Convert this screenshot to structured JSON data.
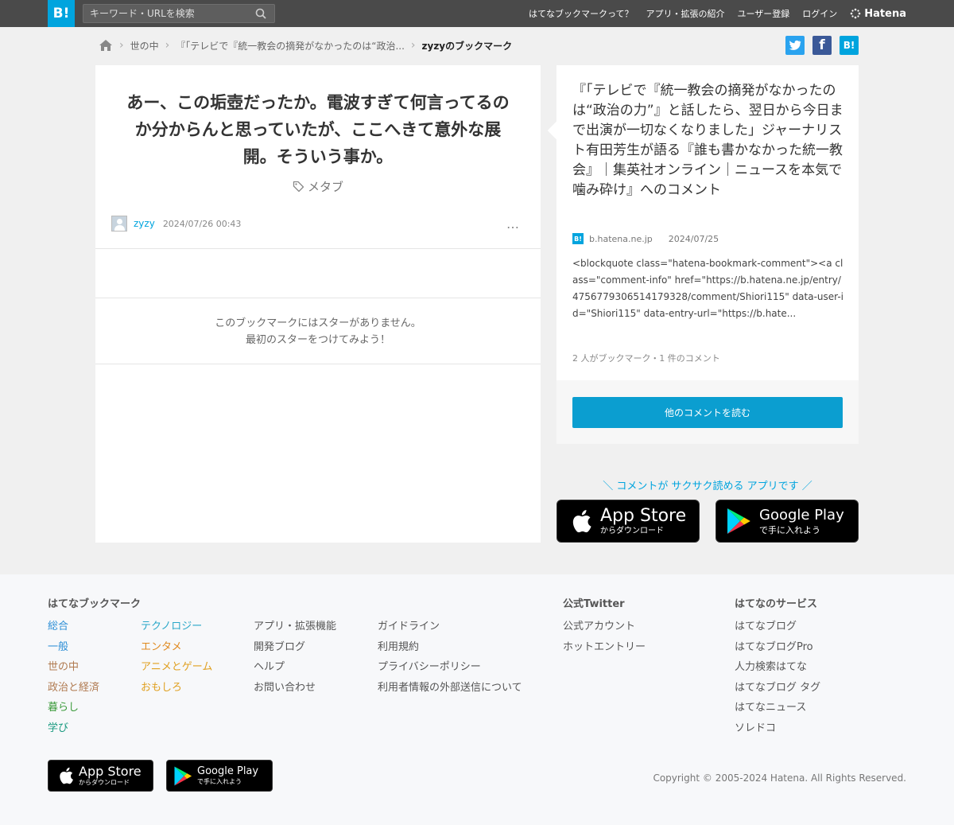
{
  "header": {
    "logo": "B!",
    "search_placeholder": "キーワード・URLを検索",
    "nav": [
      "はてなブックマークって？",
      "アプリ・拡張の紹介",
      "ユーザー登録",
      "ログイン"
    ],
    "brand": "Hatena"
  },
  "breadcrumb": [
    "世の中",
    "『「テレビで『統一教会の摘発がなかったのは“政治...",
    "zyzyのブックマーク"
  ],
  "share": {
    "twitter": "t",
    "facebook": "f",
    "hatena": "B!"
  },
  "bookmark": {
    "comment": "あー、この垢壺だったか。電波すぎて何言ってるのか分からんと思っていたが、ここへきて意外な展開。そういう事か。",
    "tag": "メタブ",
    "user": "zyzy",
    "date": "2024/07/26 00:43",
    "more": "…",
    "no_star_line1": "このブックマークにはスターがありません。",
    "no_star_line2": "最初のスターをつけてみよう！"
  },
  "entry": {
    "title": "『「テレビで『統一教会の摘発がなかったのは“政治の力”』と話したら、翌日から今日まで出演が一切なくなりました」ジャーナリスト有田芳生が語る『誰も書かなかった統一教会』｜集英社オンライン｜ニュースを本気で噛み砕け』へのコメント",
    "site": "b.hatena.ne.jp",
    "date": "2024/07/25",
    "snippet": "<blockquote class=\"hatena-bookmark-comment\"><a class=\"comment-info\" href=\"https://b.hatena.ne.jp/entry/4756779306514179328/comment/Shiori115\" data-user-id=\"Shiori115\" data-entry-url=\"https://b.hate...",
    "count": "2 人がブックマーク・1 件のコメント",
    "more_button": "他のコメントを読む"
  },
  "promo": "＼ コメントが サクサク読める アプリです ／",
  "stores": {
    "appstore_big": "App Store",
    "appstore_small": "からダウンロード",
    "googleplay_big": "Google Play",
    "googleplay_small": "で手に入れよう"
  },
  "footer": {
    "bookmark_heading": "はてなブックマーク",
    "cat_col1": [
      {
        "label": "総合",
        "color": "#2e8fd6"
      },
      {
        "label": "一般",
        "color": "#2e8fd6"
      },
      {
        "label": "世の中",
        "color": "#b07a50"
      },
      {
        "label": "政治と経済",
        "color": "#b07a50"
      },
      {
        "label": "暮らし",
        "color": "#3a9a3a"
      },
      {
        "label": "学び",
        "color": "#1a9a80"
      }
    ],
    "cat_col2": [
      {
        "label": "テクノロジー",
        "color": "#2aa7c8"
      },
      {
        "label": "エンタメ",
        "color": "#e08a20"
      },
      {
        "label": "アニメとゲーム",
        "color": "#e0a020"
      },
      {
        "label": "おもしろ",
        "color": "#e0a020"
      }
    ],
    "links_col3": [
      "アプリ・拡張機能",
      "開発ブログ",
      "ヘルプ",
      "お問い合わせ"
    ],
    "links_col4": [
      "ガイドライン",
      "利用規約",
      "プライバシーポリシー",
      "利用者情報の外部送信について"
    ],
    "twitter_heading": "公式Twitter",
    "twitter_links": [
      "公式アカウント",
      "ホットエントリー"
    ],
    "services_heading": "はてなのサービス",
    "services_links": [
      "はてなブログ",
      "はてなブログPro",
      "人力検索はてな",
      "はてなブログ タグ",
      "はてなニュース",
      "ソレドコ"
    ],
    "copyright": "Copyright © 2005-2024 Hatena. All Rights Reserved."
  },
  "colors": {
    "accent": "#00a4de",
    "twitter": "#2aa3ef",
    "facebook": "#3b5998"
  }
}
